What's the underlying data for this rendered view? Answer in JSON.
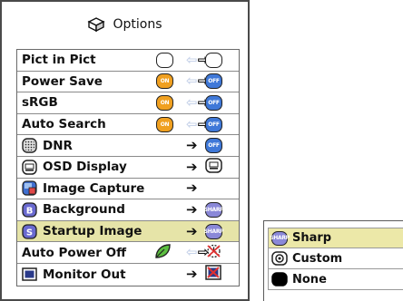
{
  "menu": {
    "title": "Options",
    "items": [
      {
        "label": "Pict in Pict",
        "icon": null,
        "left_state": "blank",
        "right_state": "blank",
        "left_text": "",
        "right_text": ""
      },
      {
        "label": "Power Save",
        "icon": null,
        "left_state": "on",
        "right_state": "off",
        "left_text": "ON",
        "right_text": "OFF"
      },
      {
        "label": "sRGB",
        "icon": null,
        "left_state": "on",
        "right_state": "off",
        "left_text": "ON",
        "right_text": "OFF"
      },
      {
        "label": "Auto Search",
        "icon": null,
        "left_state": "on",
        "right_state": "off",
        "left_text": "ON",
        "right_text": "OFF"
      },
      {
        "label": "DNR",
        "icon": "dnr-icon",
        "right_state": "off",
        "right_text": "OFF"
      },
      {
        "label": "OSD Display",
        "icon": "osd-display-icon",
        "right_state": "osd"
      },
      {
        "label": "Image Capture",
        "icon": "image-capture-icon",
        "right_state": "none"
      },
      {
        "label": "Background",
        "icon": "background-icon",
        "right_state": "sharp",
        "right_text": "SHARP"
      },
      {
        "label": "Startup Image",
        "icon": "startup-image-icon",
        "right_state": "sharp",
        "right_text": "SHARP",
        "selected": true
      },
      {
        "label": "Auto Power Off",
        "icon": null,
        "left_state": "leaf",
        "right_state": "timer"
      },
      {
        "label": "Monitor Out",
        "icon": "monitor-out-icon",
        "right_state": "crossed"
      }
    ]
  },
  "submenu": {
    "items": [
      {
        "label": "Sharp",
        "icon": "sharp-logo-icon",
        "icon_text": "SHARP",
        "selected": true
      },
      {
        "label": "Custom",
        "icon": "custom-icon"
      },
      {
        "label": "None",
        "icon": "none-icon"
      }
    ]
  },
  "colors": {
    "selected_row": "#e6e4a8",
    "on_pill": "#f0a020",
    "off_pill": "#3f78d8"
  }
}
